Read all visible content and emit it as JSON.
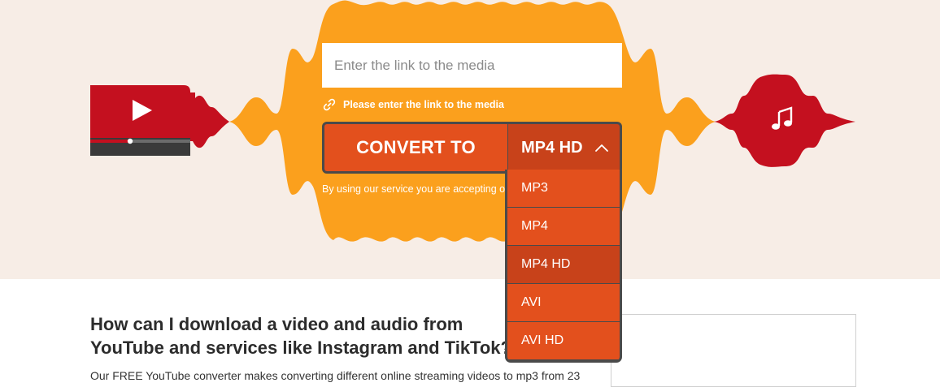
{
  "converter": {
    "url_placeholder": "Enter the link to the media",
    "hint": "Please enter the link to the media",
    "convert_label": "CONVERT TO",
    "selected_format": "MP4 HD",
    "terms_text": "By using our service you are accepting our",
    "format_options": [
      "MP3",
      "MP4",
      "MP4 HD",
      "AVI",
      "AVI HD"
    ],
    "selected_index": 2
  },
  "faq": {
    "title": "How can I download a video and audio from YouTube and services like Instagram and TikTok?",
    "text": "Our FREE YouTube converter makes converting different online streaming videos to mp3 from 23"
  },
  "colors": {
    "hero_bg": "#f7ede6",
    "orange_wave": "#fba01d",
    "accent": "#e3501d",
    "accent_dark": "#c8421a",
    "red": "#c4101f",
    "border_dark": "#4a4a4a"
  },
  "icons": {
    "video_player": "youtube-play-icon",
    "music": "music-note-icon",
    "link": "link-icon",
    "chevron": "chevron-up-icon"
  }
}
